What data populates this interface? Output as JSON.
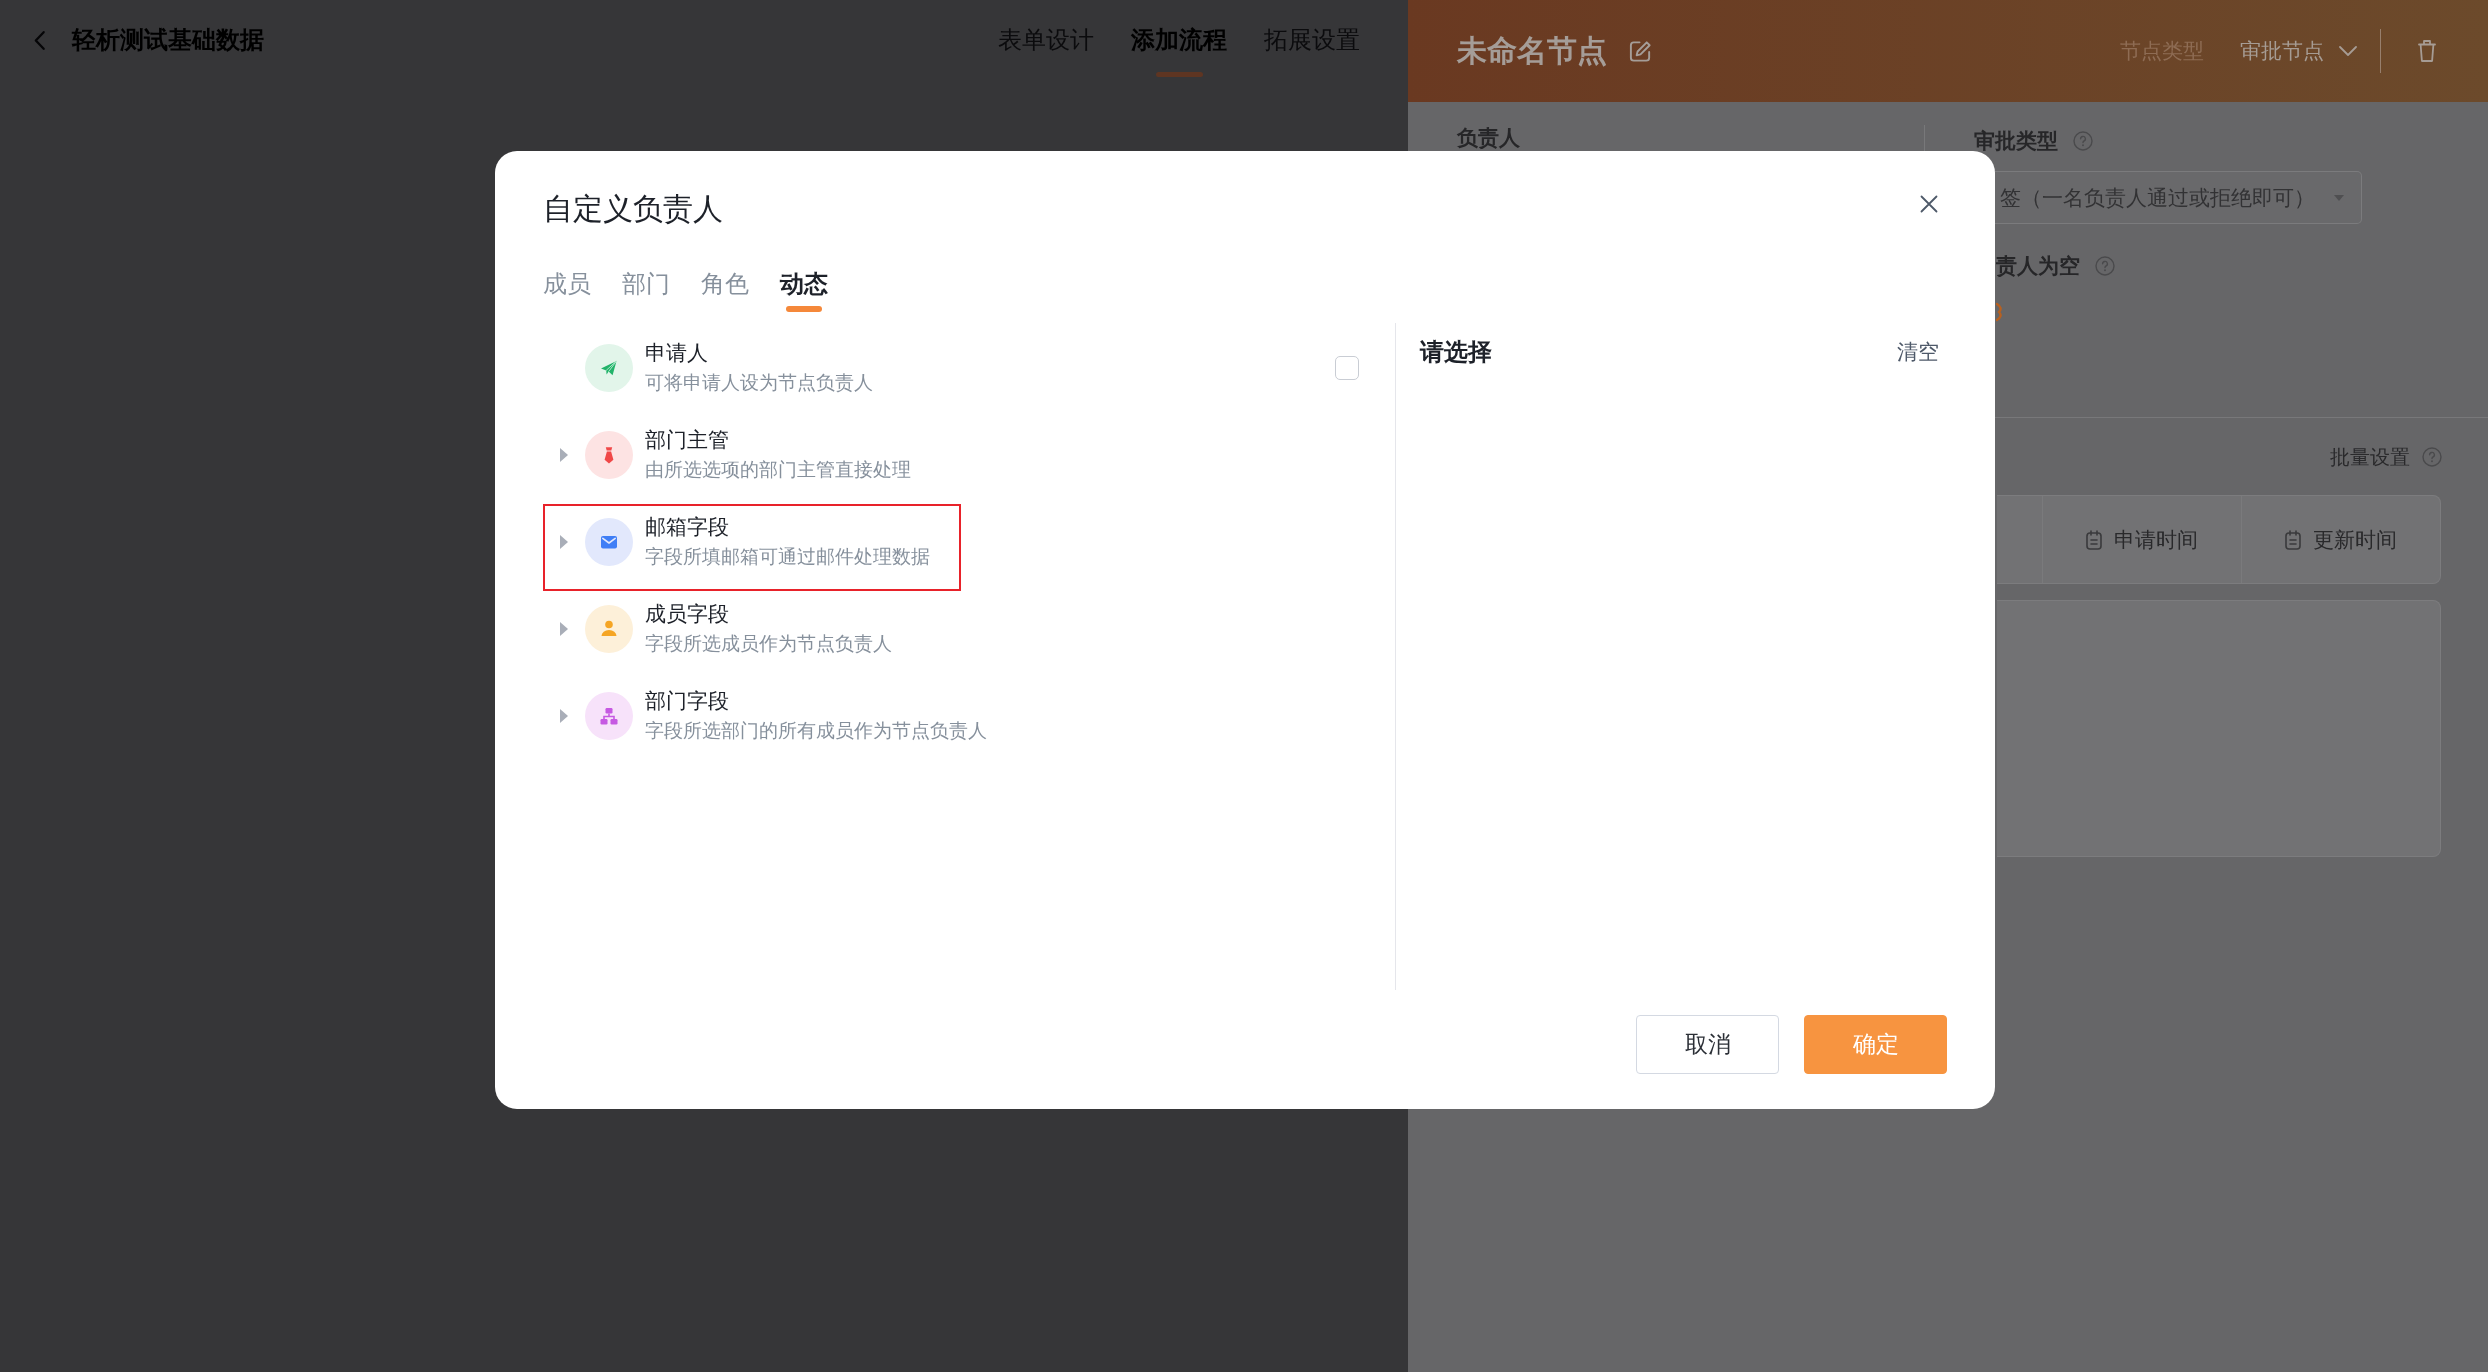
{
  "app_bar": {
    "title": "轻析测试基础数据",
    "tabs": [
      {
        "label": "表单设计",
        "selected": false
      },
      {
        "label": "添加流程",
        "selected": true
      },
      {
        "label": "拓展设置",
        "selected": false
      }
    ]
  },
  "node_panel": {
    "title": "未命名节点",
    "node_type_label": "节点类型",
    "node_type": "审批节点",
    "assignee_label": "负责人",
    "approval_type_label": "审批类型",
    "approval_type": "签（一名负责人通过或拒绝即可）",
    "empty_assignee_label": "责人为空",
    "batch_settings": "批量设置",
    "columns": [
      "申请时间",
      "更新时间"
    ]
  },
  "dialog": {
    "title": "自定义负责人",
    "tabs": [
      {
        "label": "成员",
        "selected": false
      },
      {
        "label": "部门",
        "selected": false
      },
      {
        "label": "角色",
        "selected": false
      },
      {
        "label": "动态",
        "selected": true
      }
    ],
    "options": [
      {
        "kind": "option",
        "title": "申请人",
        "description": "可将申请人设为节点负责人",
        "checked": false,
        "highlighted": false
      },
      {
        "kind": "group",
        "title": "部门主管",
        "description": "由所选选项的部门主管直接处理",
        "expanded": false,
        "highlighted": false
      },
      {
        "kind": "group",
        "title": "邮箱字段",
        "description": "字段所填邮箱可通过邮件处理数据",
        "expanded": false,
        "highlighted": true
      },
      {
        "kind": "group",
        "title": "成员字段",
        "description": "字段所选成员作为节点负责人",
        "expanded": false,
        "highlighted": false
      },
      {
        "kind": "group",
        "title": "部门字段",
        "description": "字段所选部门的所有成员作为节点负责人",
        "expanded": false,
        "highlighted": false
      }
    ],
    "selection": {
      "title": "请选择",
      "clear": "清空"
    },
    "buttons": [
      {
        "label": "取消",
        "kind": "secondary"
      },
      {
        "label": "确定",
        "kind": "primary"
      }
    ]
  }
}
